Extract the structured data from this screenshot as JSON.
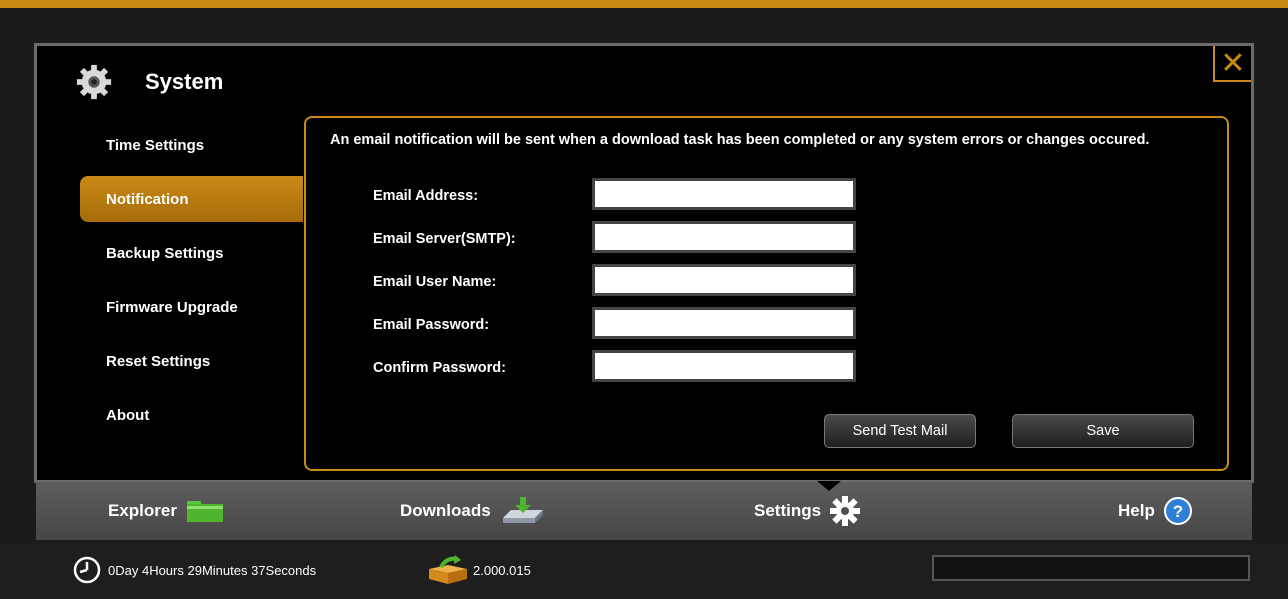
{
  "dialog": {
    "title": "System",
    "close_label": "✕"
  },
  "sidebar": {
    "items": [
      {
        "label": "Time Settings",
        "active": false
      },
      {
        "label": "Notification",
        "active": true
      },
      {
        "label": "Backup Settings",
        "active": false
      },
      {
        "label": "Firmware Upgrade",
        "active": false
      },
      {
        "label": "Reset Settings",
        "active": false
      },
      {
        "label": "About",
        "active": false
      }
    ]
  },
  "notification": {
    "description": "An email notification will be sent when a download task has been completed or any system errors or changes occured.",
    "fields": [
      {
        "label": "Email Address:",
        "value": ""
      },
      {
        "label": "Email Server(SMTP):",
        "value": ""
      },
      {
        "label": "Email User Name:",
        "value": ""
      },
      {
        "label": "Email Password:",
        "value": ""
      },
      {
        "label": "Confirm Password:",
        "value": ""
      }
    ],
    "send_test_label": "Send Test Mail",
    "save_label": "Save"
  },
  "nav": {
    "items": [
      {
        "label": "Explorer",
        "icon": "folder-icon"
      },
      {
        "label": "Downloads",
        "icon": "download-drive-icon"
      },
      {
        "label": "Settings",
        "icon": "gear-icon",
        "active": true
      },
      {
        "label": "Help",
        "icon": "help-icon"
      }
    ]
  },
  "status": {
    "uptime": "0Day 4Hours 29Minutes 37Seconds",
    "version": "2.000.015",
    "progress_fraction": 0.0
  },
  "colors": {
    "accent": "#c98a15",
    "nav": "#555555",
    "help": "#2f7fd8"
  }
}
